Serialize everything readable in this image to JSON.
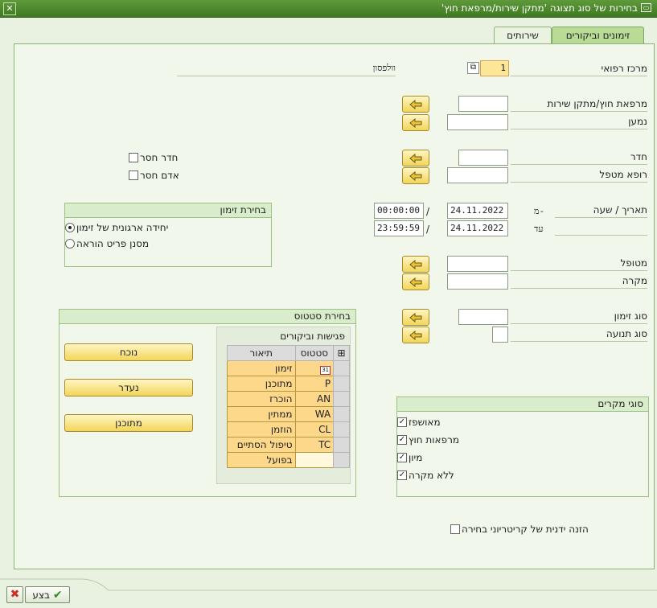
{
  "window": {
    "title": "בחירות של סוג תצוגה 'מתקן שירות/מרפאת חוץ'",
    "close_icon": "close-icon",
    "title_icon": "window-icon"
  },
  "tabs": [
    {
      "label": "זימונים וביקורים",
      "active": true
    },
    {
      "label": "שירותים",
      "active": false
    }
  ],
  "form": {
    "medical_center": {
      "label": "מרכז רפואי",
      "value": "1",
      "desc": "וולפסון"
    },
    "clinic": {
      "label": "מרפאת חוץ/מתקן שירות",
      "value": ""
    },
    "recipient": {
      "label": "נמען",
      "value": ""
    },
    "room": {
      "label": "חדר",
      "value": ""
    },
    "physician": {
      "label": "רופא מטפל",
      "value": ""
    },
    "date_time": {
      "label": "תאריך / שעה",
      "from_label": "מ-",
      "to_label": "עד",
      "sep": "/",
      "from_date": "24.11.2022",
      "from_time": "00:00:00",
      "to_date": "24.11.2022",
      "to_time": "23:59:59"
    },
    "patient": {
      "label": "מטופל",
      "value": ""
    },
    "case": {
      "label": "מקרה",
      "value": ""
    },
    "appt_type": {
      "label": "סוג זימון",
      "value": ""
    },
    "movement_type": {
      "label": "סוג תנועה",
      "value": ""
    }
  },
  "checks_right": {
    "missing_room": {
      "label": "חדר חסר",
      "checked": false
    },
    "missing_person": {
      "label": "אדם חסר",
      "checked": false
    }
  },
  "appt_selection": {
    "title": "בחירת זימון",
    "options": [
      {
        "label": "יחידה ארגונית של זימון",
        "selected": true
      },
      {
        "label": "מסנן פריט הוראה",
        "selected": false
      }
    ]
  },
  "status_selection": {
    "title": "בחירת סטטוס",
    "table": {
      "title": "פגישות וביקורים",
      "col_status": "סטטוס",
      "col_desc": "תיאור",
      "rows": [
        {
          "status": "",
          "desc": "זימון",
          "icon": true
        },
        {
          "status": "P",
          "desc": "מתוכנן"
        },
        {
          "status": "AN",
          "desc": "הוכרז"
        },
        {
          "status": "WA",
          "desc": "ממתין"
        },
        {
          "status": "CL",
          "desc": "הוזמן"
        },
        {
          "status": "TC",
          "desc": "טיפול הסתיים"
        },
        {
          "status": "",
          "desc": "בפועל"
        }
      ]
    },
    "buttons": [
      "נוכח",
      "נעדר",
      "מתוכנן"
    ]
  },
  "case_types": {
    "title": "סוגי מקרים",
    "items": [
      {
        "label": "מאושפז",
        "checked": true
      },
      {
        "label": "מרפאות חוץ",
        "checked": true
      },
      {
        "label": "מיון",
        "checked": true
      },
      {
        "label": "ללא מקרה",
        "checked": true
      }
    ]
  },
  "manual_entry": {
    "label": "הזנה ידנית של קריטריוני בחירה",
    "checked": false
  },
  "footer": {
    "execute_label": "בצע",
    "cancel_icon": "cancel-icon"
  },
  "colors": {
    "titlebar": "#4a8a2c",
    "required": "#fde698",
    "button": "#f2d55a",
    "cell": "#fdd88a"
  }
}
